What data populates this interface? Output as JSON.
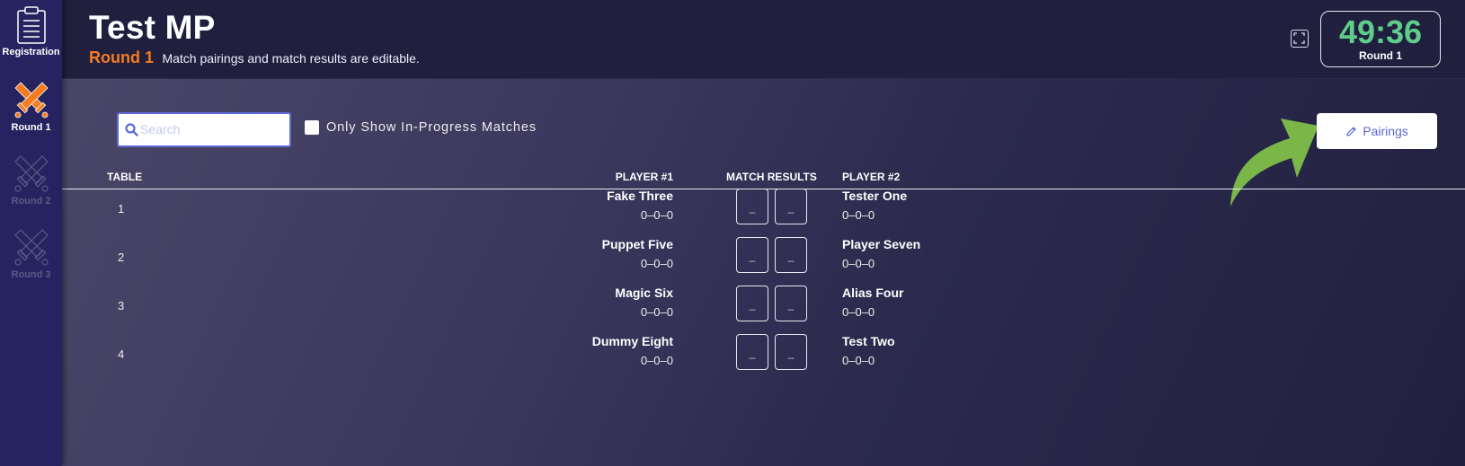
{
  "sidebar": {
    "items": [
      {
        "label": "Registration",
        "icon": "clipboard-icon",
        "state": "normal"
      },
      {
        "label": "Round 1",
        "icon": "crossed-swords-icon",
        "state": "active"
      },
      {
        "label": "Round 2",
        "icon": "crossed-swords-icon",
        "state": "disabled"
      },
      {
        "label": "Round 3",
        "icon": "crossed-swords-icon",
        "state": "disabled"
      }
    ]
  },
  "header": {
    "title": "Test MP",
    "round_label": "Round 1",
    "description": "Match pairings and match results are editable.",
    "timer": {
      "time": "49:36",
      "label": "Round 1"
    }
  },
  "toolbar": {
    "search_placeholder": "Search",
    "search_value": "",
    "filter_label": "Only Show In-Progress Matches",
    "filter_checked": false,
    "pairings_label": "Pairings"
  },
  "table": {
    "headers": {
      "table": "TABLE",
      "player1": "PLAYER #1",
      "results": "MATCH RESULTS",
      "player2": "PLAYER #2"
    },
    "rows": [
      {
        "table": "1",
        "p1": "Fake Three",
        "p1_record": "0–0–0",
        "r1": "_",
        "r2": "_",
        "p2": "Tester One",
        "p2_record": "0–0–0"
      },
      {
        "table": "2",
        "p1": "Puppet Five",
        "p1_record": "0–0–0",
        "r1": "_",
        "r2": "_",
        "p2": "Player Seven",
        "p2_record": "0–0–0"
      },
      {
        "table": "3",
        "p1": "Magic Six",
        "p1_record": "0–0–0",
        "r1": "_",
        "r2": "_",
        "p2": "Alias Four",
        "p2_record": "0–0–0"
      },
      {
        "table": "4",
        "p1": "Dummy Eight",
        "p1_record": "0–0–0",
        "r1": "_",
        "r2": "_",
        "p2": "Test Two",
        "p2_record": "0–0–0"
      }
    ]
  },
  "colors": {
    "accent_orange": "#f47c20",
    "timer_green": "#5fcc8a",
    "button_blue": "#5867d6",
    "arrow_green": "#7ab648"
  }
}
